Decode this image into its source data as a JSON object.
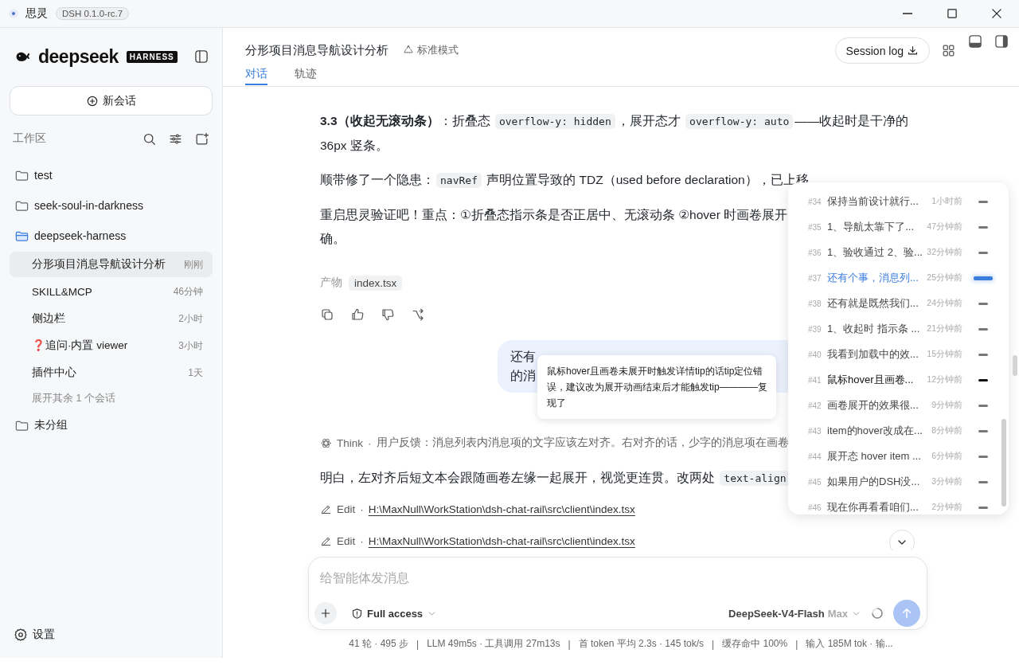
{
  "titlebar": {
    "app_name": "思灵",
    "version": "DSH 0.1.0-rc.7"
  },
  "sidebar": {
    "brand": "deepseek",
    "brand_badge": "HARNESS",
    "new_chat": "新会话",
    "workspace_label": "工作区",
    "tree": [
      {
        "name": "test",
        "expanded": false
      },
      {
        "name": "seek-soul-in-darkness",
        "expanded": false
      },
      {
        "name": "deepseek-harness",
        "expanded": true,
        "more": "展开其余 1 个会话",
        "children": [
          {
            "name": "分形项目消息导航设计分析",
            "time": "刚刚",
            "selected": true
          },
          {
            "name": "SKILL&MCP",
            "time": "46分钟",
            "selected": false
          },
          {
            "name": "侧边栏",
            "time": "2小时",
            "selected": false
          },
          {
            "name": "❓追问·内置 viewer",
            "time": "3小时",
            "selected": false
          },
          {
            "name": "插件中心",
            "time": "1天",
            "selected": false
          }
        ]
      },
      {
        "name": "未分组",
        "expanded": false
      }
    ],
    "settings": "设置"
  },
  "header": {
    "title": "分形项目消息导航设计分析",
    "mode": "标准模式",
    "session_log": "Session log",
    "tabs": [
      {
        "label": "对话",
        "selected": true
      },
      {
        "label": "轨迹",
        "selected": false
      }
    ]
  },
  "messages": [
    {
      "kind": "paragraph",
      "lines": [
        [
          {
            "kind": "bold",
            "text": "3.3（收起无滚动条）"
          },
          {
            "kind": "text",
            "text": "：折叠态 "
          },
          {
            "kind": "code",
            "text": "overflow-y: hidden"
          },
          {
            "kind": "text",
            "text": "，展开态才 "
          },
          {
            "kind": "code",
            "text": "overflow-y: auto"
          },
          {
            "kind": "text",
            "text": "——收起时是干净的"
          }
        ],
        [
          {
            "kind": "text",
            "text": "36px 竖条。"
          }
        ]
      ]
    },
    {
      "kind": "paragraph",
      "lines": [
        [
          {
            "kind": "text",
            "text": "顺带修了一个隐患："
          },
          {
            "kind": "code",
            "text": "navRef"
          },
          {
            "kind": "text",
            "text": " 声明位置导致的 TDZ（used before declaration），已上移"
          }
        ]
      ]
    },
    {
      "kind": "paragraph",
      "lines": [
        [
          {
            "kind": "text",
            "text": "重启思灵验证吧！重点：①折叠态指示条是否正居中、无滚动条 ②hover 时画卷展开"
          }
        ],
        [
          {
            "kind": "text",
            "text": "确。"
          }
        ]
      ]
    },
    {
      "kind": "artifacts",
      "label": "产物",
      "files": [
        "index.tsx"
      ]
    },
    {
      "kind": "actions"
    },
    {
      "kind": "user",
      "lines": [
        "还有",
        "的消"
      ]
    },
    {
      "kind": "think",
      "label": "Think",
      "separator": "·",
      "text": "用户反馈：消息列表内消息项的文字应该左对齐。右对齐的话，少字的消息项在画卷"
    },
    {
      "kind": "paragraph",
      "lines": [
        [
          {
            "kind": "text",
            "text": "明白，左对齐后短文本会跟随画卷左缘一起展开，视觉更连贯。改两处 "
          },
          {
            "kind": "code",
            "text": "text-align"
          }
        ]
      ]
    },
    {
      "kind": "tool",
      "label": "Edit",
      "separator": "·",
      "path": "H:\\MaxNull\\WorkStation\\dsh-chat-rail\\src\\client\\index.tsx"
    },
    {
      "kind": "tool",
      "label": "Edit",
      "separator": "·",
      "path": "H:\\MaxNull\\WorkStation\\dsh-chat-rail\\src\\client\\index.tsx"
    }
  ],
  "tooltip": {
    "text": "鼠标hover且画卷未展开时触发详情tip的话tip定位错误，建议改为展开动画结束后才能触发tip————复现了"
  },
  "nav": {
    "items": [
      {
        "index": "#34",
        "text": "保持当前设计就行...",
        "time": "1小时前",
        "selected": false,
        "hovered": false
      },
      {
        "index": "#35",
        "text": "1、导航太靠下了...",
        "time": "47分钟前",
        "selected": false,
        "hovered": false
      },
      {
        "index": "#36",
        "text": "1、验收通过 2、验...",
        "time": "32分钟前",
        "selected": false,
        "hovered": false
      },
      {
        "index": "#37",
        "text": "还有个事，消息列...",
        "time": "25分钟前",
        "selected": true,
        "hovered": false
      },
      {
        "index": "#38",
        "text": "还有就是既然我们...",
        "time": "24分钟前",
        "selected": false,
        "hovered": false
      },
      {
        "index": "#39",
        "text": "1、收起时 指示条 ...",
        "time": "21分钟前",
        "selected": false,
        "hovered": false
      },
      {
        "index": "#40",
        "text": "我看到加载中的效...",
        "time": "15分钟前",
        "selected": false,
        "hovered": false
      },
      {
        "index": "#41",
        "text": "鼠标hover且画卷...",
        "time": "12分钟前",
        "selected": false,
        "hovered": true
      },
      {
        "index": "#42",
        "text": "画卷展开的效果很...",
        "time": "9分钟前",
        "selected": false,
        "hovered": false
      },
      {
        "index": "#43",
        "text": "item的hover改成在...",
        "time": "8分钟前",
        "selected": false,
        "hovered": false
      },
      {
        "index": "#44",
        "text": "展开态 hover item ...",
        "time": "6分钟前",
        "selected": false,
        "hovered": false
      },
      {
        "index": "#45",
        "text": "如果用户的DSH没...",
        "time": "3分钟前",
        "selected": false,
        "hovered": false
      },
      {
        "index": "#46",
        "text": "现在你再看看咱们...",
        "time": "2分钟前",
        "selected": false,
        "hovered": false
      }
    ]
  },
  "composer": {
    "placeholder": "给智能体发消息",
    "access": "Full access",
    "model": "DeepSeek-V4-Flash",
    "effort": "Max"
  },
  "status_bar": {
    "separator": "|",
    "items": [
      "41 轮 · 495 步",
      "LLM 49m5s · 工具调用 27m13s",
      "首 token 平均 2.3s · 145 tok/s",
      "缓存命中 100%",
      "输入 185M tok · 输..."
    ]
  }
}
